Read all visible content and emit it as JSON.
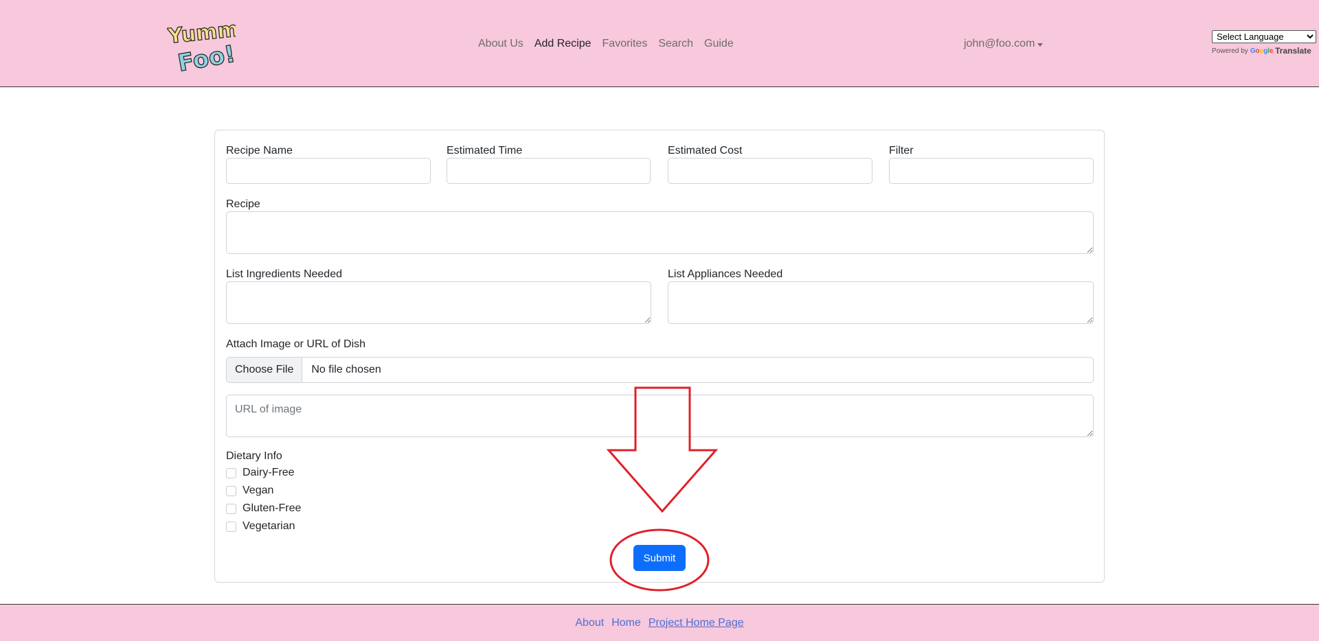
{
  "brand": {
    "logo_text_top": "Yummy",
    "logo_text_bottom": "Foo!"
  },
  "nav": {
    "links": [
      {
        "label": "About Us",
        "active": false
      },
      {
        "label": "Add Recipe",
        "active": true
      },
      {
        "label": "Favorites",
        "active": false
      },
      {
        "label": "Search",
        "active": false
      },
      {
        "label": "Guide",
        "active": false
      }
    ],
    "user": "john@foo.com"
  },
  "translate": {
    "select_label": "Select Language",
    "powered_by": "Powered by",
    "google": "Google",
    "translate": "Translate"
  },
  "form": {
    "recipe_name_label": "Recipe Name",
    "estimated_time_label": "Estimated Time",
    "estimated_cost_label": "Estimated Cost",
    "filter_label": "Filter",
    "recipe_label": "Recipe",
    "ingredients_label": "List Ingredients Needed",
    "appliances_label": "List Appliances Needed",
    "image_label": "Attach Image or URL of Dish",
    "file_button": "Choose File",
    "file_status": "No file chosen",
    "url_placeholder": "URL of image",
    "dietary_label": "Dietary Info",
    "dietary_options": [
      "Dairy-Free",
      "Vegan",
      "Gluten-Free",
      "Vegetarian"
    ],
    "submit_label": "Submit"
  },
  "footer": {
    "links": [
      {
        "label": "About"
      },
      {
        "label": "Home"
      },
      {
        "label": "Project Home Page"
      }
    ]
  },
  "colors": {
    "header_bg": "#f8c8dc",
    "primary": "#0d6efd",
    "annotation": "#e0202a",
    "footer_link": "#4c6fd4"
  }
}
